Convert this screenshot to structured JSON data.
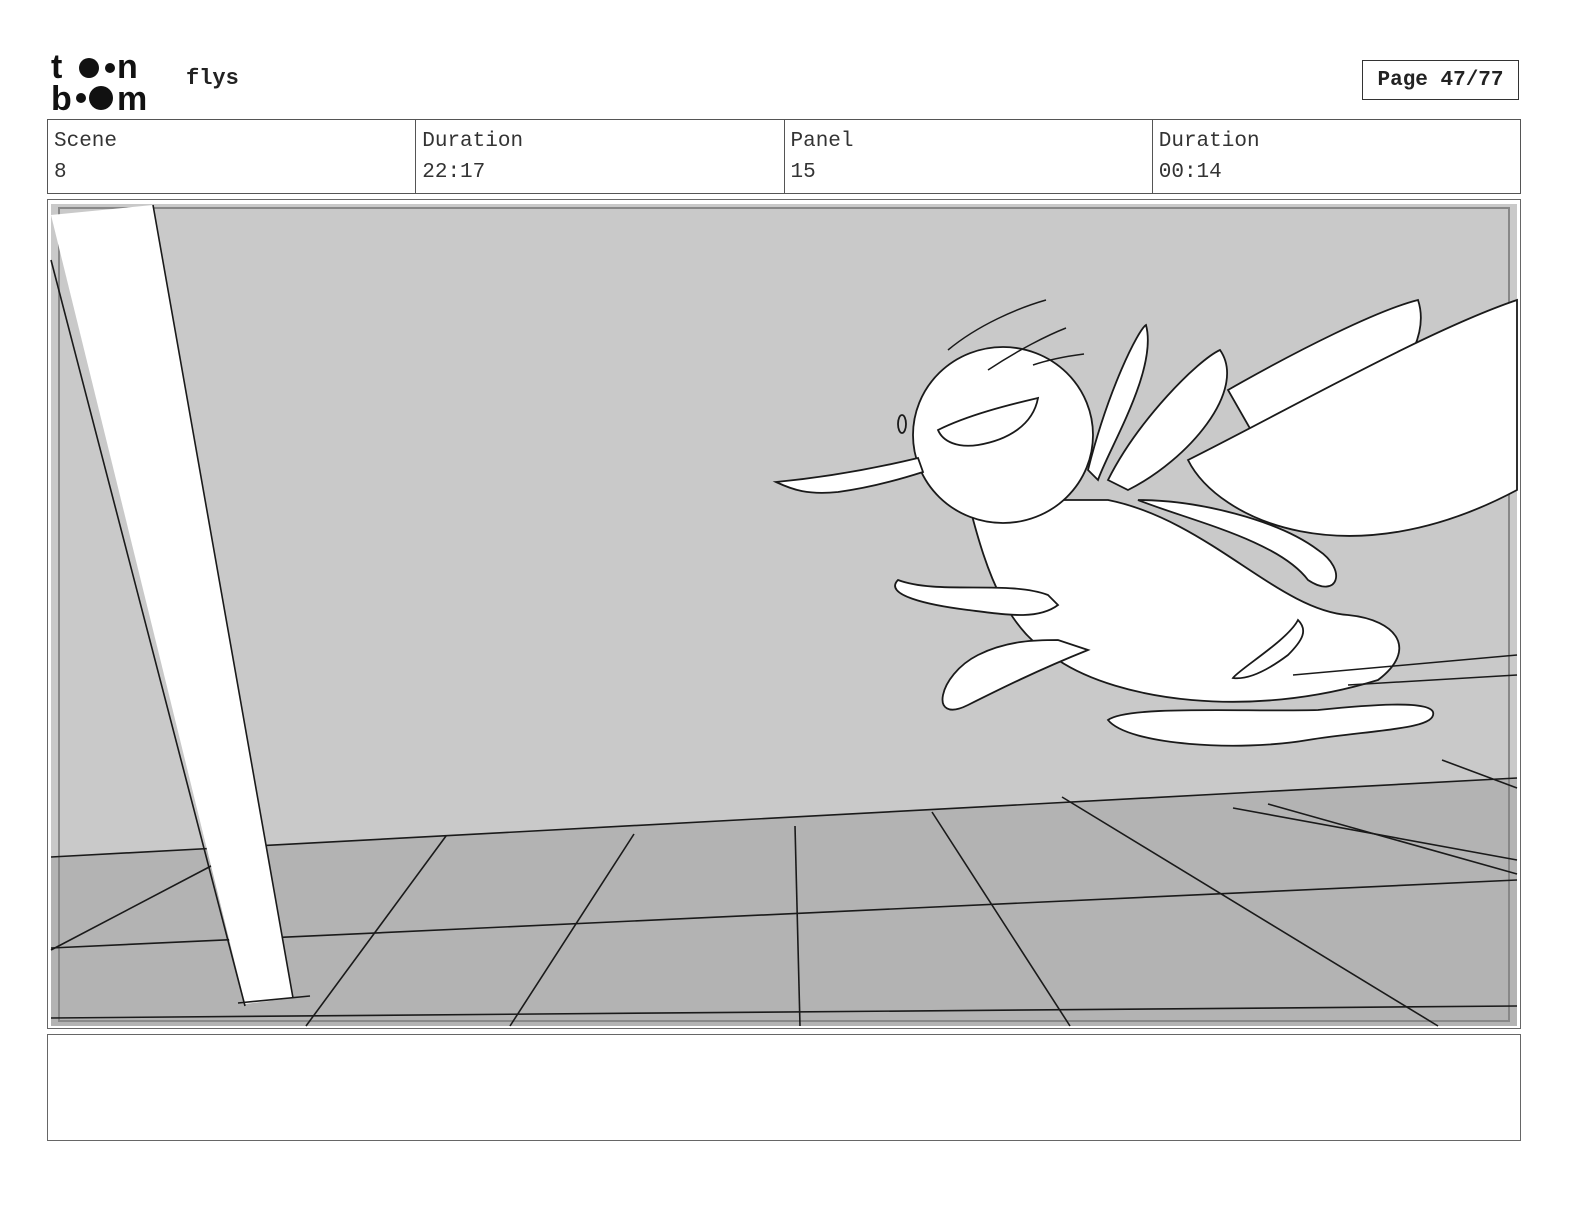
{
  "header": {
    "logo_alt": "toonboom",
    "project_name": "flys",
    "page_label": "Page 47/77"
  },
  "info": {
    "scene_label": "Scene",
    "scene_value": "8",
    "duration_label": "Duration",
    "duration_value": "22:17",
    "panel_label": "Panel",
    "panel_value": "15",
    "panel_duration_label": "Duration",
    "panel_duration_value": "00:14"
  },
  "panel": {
    "image_description": "Rough storyboard sketch: cartoon fly flying right-to-left over a tiled floor past a white pole, gray background",
    "colors": {
      "wall": "#c9c9c9",
      "floor": "#b3b3b3",
      "line": "#1a1a1a"
    }
  },
  "notes": {
    "text": ""
  }
}
